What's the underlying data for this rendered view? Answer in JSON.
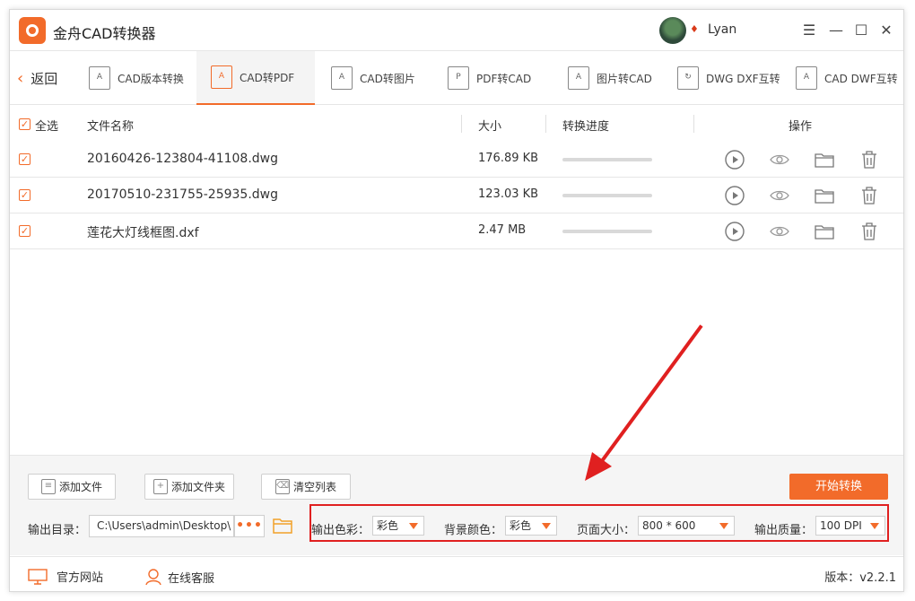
{
  "app": {
    "title": "金舟CAD转换器",
    "username": "Lyan"
  },
  "window_controls": {
    "menu": "☰",
    "minimize": "—",
    "maximize": "☐",
    "close": "✕"
  },
  "toolbar": {
    "back_label": "返回",
    "tools": [
      {
        "label": "CAD版本转换",
        "active": false
      },
      {
        "label": "CAD转PDF",
        "active": true
      },
      {
        "label": "CAD转图片",
        "active": false
      },
      {
        "label": "PDF转CAD",
        "active": false
      },
      {
        "label": "图片转CAD",
        "active": false
      },
      {
        "label": "DWG DXF互转",
        "active": false
      },
      {
        "label": "CAD DWF互转",
        "active": false
      }
    ]
  },
  "table": {
    "select_all": "全选",
    "columns": {
      "name": "文件名称",
      "size": "大小",
      "progress": "转换进度",
      "actions": "操作"
    },
    "rows": [
      {
        "checked": true,
        "name": "20160426-123804-41108.dwg",
        "size": "176.89 KB",
        "progress": 0
      },
      {
        "checked": true,
        "name": "20170510-231755-25935.dwg",
        "size": "123.03 KB",
        "progress": 0
      },
      {
        "checked": true,
        "name": "莲花大灯线框图.dxf",
        "size": "2.47 MB",
        "progress": 0
      }
    ]
  },
  "bottom": {
    "add_file": "添加文件",
    "add_folder": "添加文件夹",
    "clear_list": "清空列表",
    "start": "开始转换",
    "output_dir_label": "输出目录：",
    "output_dir_value": "C:\\Users\\admin\\Desktop\\",
    "dots": "•••",
    "options": {
      "color_label": "输出色彩：",
      "color_value": "彩色",
      "bg_label": "背景颜色：",
      "bg_value": "彩色",
      "page_label": "页面大小：",
      "page_value": "800 * 600",
      "quality_label": "输出质量：",
      "quality_value": "100 DPI"
    }
  },
  "footer": {
    "website": "官方网站",
    "service": "在线客服",
    "version": "版本：v2.2.1"
  },
  "colors": {
    "accent": "#f26b2a",
    "annotation": "#e02020"
  }
}
